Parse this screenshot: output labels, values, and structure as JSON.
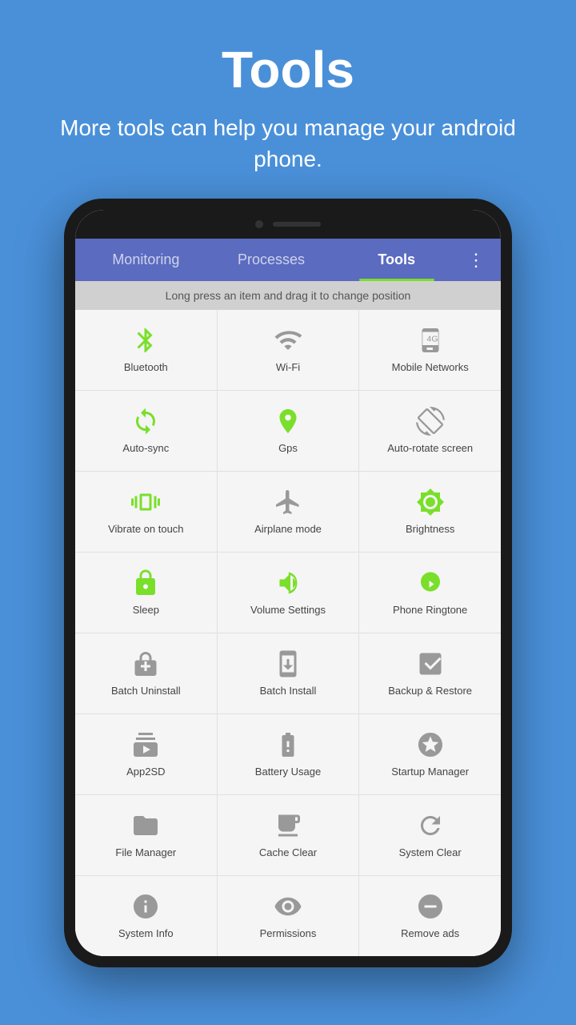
{
  "header": {
    "title": "Tools",
    "subtitle": "More tools can help you manage your android phone."
  },
  "tabs": [
    {
      "label": "Monitoring",
      "active": false
    },
    {
      "label": "Processes",
      "active": false
    },
    {
      "label": "Tools",
      "active": true
    }
  ],
  "menu_icon": "⋮",
  "drag_hint": "Long press an item and drag it to change position",
  "tools": [
    {
      "id": "bluetooth",
      "label": "Bluetooth",
      "color": "green"
    },
    {
      "id": "wifi",
      "label": "Wi-Fi",
      "color": "gray"
    },
    {
      "id": "mobile-networks",
      "label": "Mobile Networks",
      "color": "gray"
    },
    {
      "id": "auto-sync",
      "label": "Auto-sync",
      "color": "green"
    },
    {
      "id": "gps",
      "label": "Gps",
      "color": "green"
    },
    {
      "id": "auto-rotate",
      "label": "Auto-rotate screen",
      "color": "gray"
    },
    {
      "id": "vibrate",
      "label": "Vibrate on touch",
      "color": "green"
    },
    {
      "id": "airplane",
      "label": "Airplane mode",
      "color": "gray"
    },
    {
      "id": "brightness",
      "label": "Brightness",
      "color": "green"
    },
    {
      "id": "sleep",
      "label": "Sleep",
      "color": "green"
    },
    {
      "id": "volume",
      "label": "Volume Settings",
      "color": "green"
    },
    {
      "id": "ringtone",
      "label": "Phone Ringtone",
      "color": "green"
    },
    {
      "id": "batch-uninstall",
      "label": "Batch Uninstall",
      "color": "gray"
    },
    {
      "id": "batch-install",
      "label": "Batch Install",
      "color": "gray"
    },
    {
      "id": "backup",
      "label": "Backup & Restore",
      "color": "gray"
    },
    {
      "id": "app2sd",
      "label": "App2SD",
      "color": "gray"
    },
    {
      "id": "battery",
      "label": "Battery Usage",
      "color": "gray"
    },
    {
      "id": "startup",
      "label": "Startup Manager",
      "color": "gray"
    },
    {
      "id": "file-manager",
      "label": "File Manager",
      "color": "gray"
    },
    {
      "id": "cache-clear",
      "label": "Cache Clear",
      "color": "gray"
    },
    {
      "id": "system-clear",
      "label": "System Clear",
      "color": "gray"
    },
    {
      "id": "system-info",
      "label": "System Info",
      "color": "gray"
    },
    {
      "id": "permissions",
      "label": "Permissions",
      "color": "gray"
    },
    {
      "id": "remove-ads",
      "label": "Remove ads",
      "color": "gray"
    }
  ]
}
